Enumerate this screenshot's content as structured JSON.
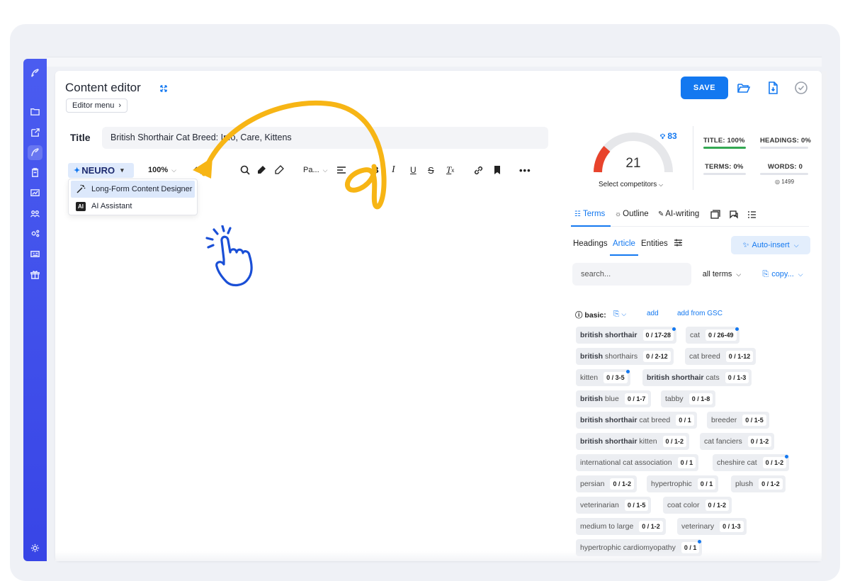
{
  "editor": {
    "title": "Content editor",
    "menu_label": "Editor menu",
    "save_label": "SAVE",
    "title_field_label": "Title",
    "title_value": "British Shorthair Cat Breed: Info, Care, Kittens"
  },
  "toolbar": {
    "neuro_label": "NEURO",
    "zoom": "100%",
    "paragraph": "Pa..."
  },
  "dropdown": {
    "items": [
      {
        "label": "Long-Form Content Designer",
        "icon": "magic-wand-icon"
      },
      {
        "label": "AI Assistant",
        "icon_text": "AI"
      }
    ]
  },
  "score": {
    "value": "21",
    "badge": "83",
    "select_competitors": "Select competitors",
    "title_stat": "TITLE: 100%",
    "headings_stat": "HEADINGS: 0%",
    "terms_stat": "TERMS: 0%",
    "words_stat": "WORDS: 0",
    "words_sub": "1499",
    "title_progress": 1.0,
    "headings_progress": 0,
    "terms_progress": 0,
    "words_progress": 0
  },
  "tabs": {
    "terms": "Terms",
    "outline": "Outline",
    "ai_writing": "AI-writing"
  },
  "subtabs": {
    "headings": "Headings",
    "article": "Article",
    "entities": "Entities",
    "auto_insert": "Auto-insert"
  },
  "filters": {
    "search_placeholder": "search...",
    "all_terms": "all terms",
    "copy": "copy..."
  },
  "basic": {
    "label": "basic:",
    "add": "add",
    "add_gsc": "add from GSC"
  },
  "terms": [
    {
      "bold": "british shorthair",
      "rest": "",
      "count": "0 / 17-28",
      "dot": true
    },
    {
      "bold": "",
      "rest": "cat",
      "count": "0 / 26-49",
      "dot": true
    },
    {
      "bold": "british",
      "rest": " shorthairs",
      "count": "0 / 2-12",
      "dot": false
    },
    {
      "bold": "",
      "rest": "cat breed",
      "count": "0 / 1-12",
      "dot": false
    },
    {
      "bold": "",
      "rest": "kitten",
      "count": "0 / 3-5",
      "dot": true
    },
    {
      "bold": "british shorthair",
      "rest": " cats",
      "count": "0 / 1-3",
      "dot": false
    },
    {
      "bold": "british",
      "rest": " blue",
      "count": "0 / 1-7",
      "dot": false
    },
    {
      "bold": "",
      "rest": "tabby",
      "count": "0 / 1-8",
      "dot": false
    },
    {
      "bold": "british shorthair",
      "rest": " cat breed",
      "count": "0 / 1",
      "dot": false
    },
    {
      "bold": "",
      "rest": "breeder",
      "count": "0 / 1-5",
      "dot": false
    },
    {
      "bold": "british shorthair",
      "rest": " kitten",
      "count": "0 / 1-2",
      "dot": false
    },
    {
      "bold": "",
      "rest": "cat fanciers",
      "count": "0 / 1-2",
      "dot": false
    },
    {
      "bold": "",
      "rest": "international cat association",
      "count": "0 / 1",
      "dot": false
    },
    {
      "bold": "",
      "rest": "cheshire cat",
      "count": "0 / 1-2",
      "dot": true
    },
    {
      "bold": "",
      "rest": "persian",
      "count": "0 / 1-2",
      "dot": false
    },
    {
      "bold": "",
      "rest": "hypertrophic",
      "count": "0 / 1",
      "dot": false
    },
    {
      "bold": "",
      "rest": "plush",
      "count": "0 / 1-2",
      "dot": false
    },
    {
      "bold": "",
      "rest": "veterinarian",
      "count": "0 / 1-5",
      "dot": false
    },
    {
      "bold": "",
      "rest": "coat color",
      "count": "0 / 1-2",
      "dot": false
    },
    {
      "bold": "",
      "rest": "medium to large",
      "count": "0 / 1-2",
      "dot": false
    },
    {
      "bold": "",
      "rest": "veterinary",
      "count": "0 / 1-3",
      "dot": false
    },
    {
      "bold": "",
      "rest": "hypertrophic cardiomyopathy",
      "count": "0 / 1",
      "dot": true
    }
  ],
  "colors": {
    "accent": "#1378f0",
    "sidebar": "#3f4fe9",
    "arrow": "#f7b515",
    "hand": "#1a4fd6",
    "gauge_red": "#e8432c",
    "progress_green": "#33a852"
  }
}
